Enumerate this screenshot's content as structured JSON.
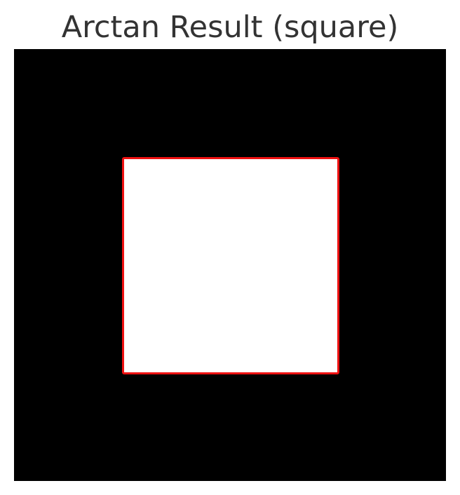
{
  "figure": {
    "title": "Arctan Result (square)",
    "background_color": "#000000",
    "shape": {
      "kind": "square",
      "fill_color": "#ffffff",
      "outline_color": "#ee1111"
    }
  }
}
